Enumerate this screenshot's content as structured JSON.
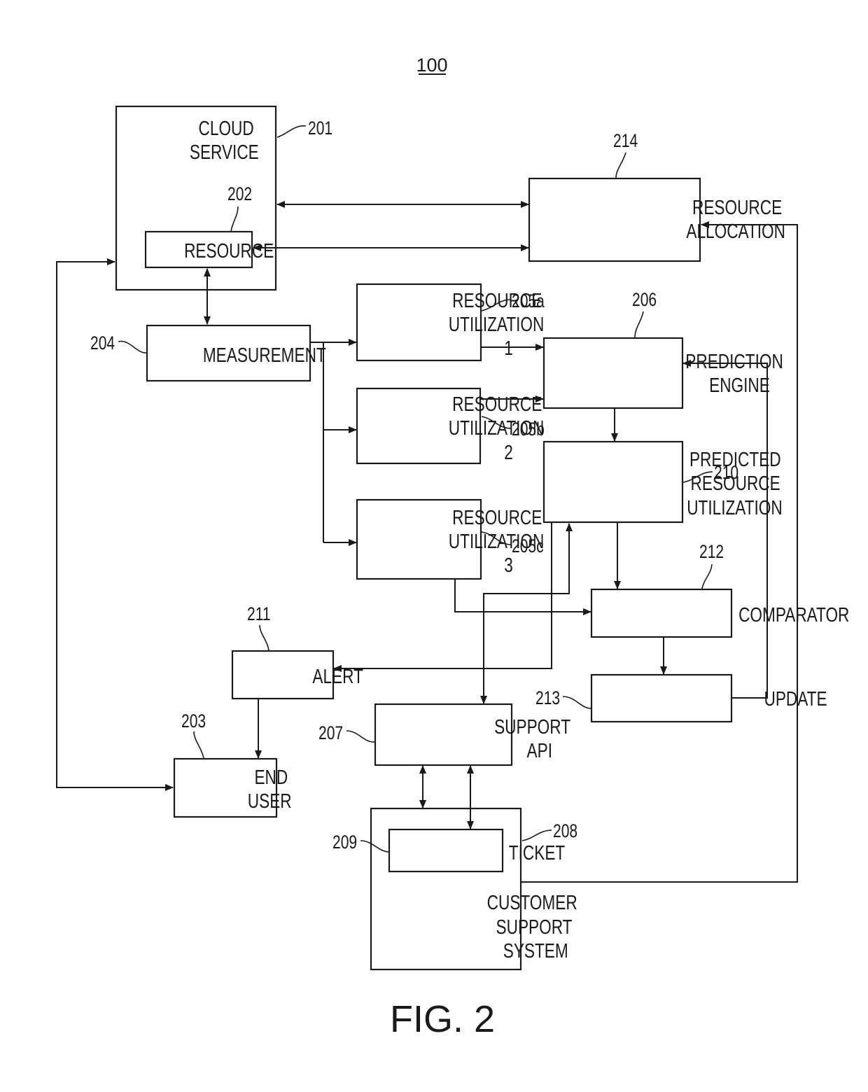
{
  "figure": {
    "number_label": "100",
    "caption": "FIG. 2"
  },
  "nodes": {
    "cloud_service": {
      "ref": "201",
      "lines": [
        "CLOUD",
        "SERVICE"
      ]
    },
    "resource": {
      "ref": "202",
      "lines": [
        "RESOURCE"
      ]
    },
    "end_user": {
      "ref": "203",
      "lines": [
        "END",
        "USER"
      ]
    },
    "measurement": {
      "ref": "204",
      "lines": [
        "MEASUREMENT"
      ]
    },
    "resource_utilization_1": {
      "ref": "205a",
      "lines": [
        "RESOURCE",
        "UTILIZATION",
        "1"
      ]
    },
    "resource_utilization_2": {
      "ref": "205b",
      "lines": [
        "RESOURCE",
        "UTILIZATION",
        "2"
      ]
    },
    "resource_utilization_3": {
      "ref": "205c",
      "lines": [
        "RESOURCE",
        "UTILIZATION",
        "3"
      ]
    },
    "prediction_engine": {
      "ref": "206",
      "lines": [
        "PREDICTION",
        "ENGINE"
      ]
    },
    "support_api": {
      "ref": "207",
      "lines": [
        "SUPPORT",
        "API"
      ]
    },
    "customer_support_system": {
      "ref": "208",
      "lines": [
        "CUSTOMER",
        "SUPPORT",
        "SYSTEM"
      ]
    },
    "ticket": {
      "ref": "209",
      "lines": [
        "TICKET"
      ]
    },
    "predicted_resource_utilization": {
      "ref": "210",
      "lines": [
        "PREDICTED",
        "RESOURCE",
        "UTILIZATION"
      ]
    },
    "alert": {
      "ref": "211",
      "lines": [
        "ALERT"
      ]
    },
    "comparator": {
      "ref": "212",
      "lines": [
        "COMPARATOR"
      ]
    },
    "update": {
      "ref": "213",
      "lines": [
        "UPDATE"
      ]
    },
    "resource_allocation": {
      "ref": "214",
      "lines": [
        "RESOURCE",
        "ALLOCATION"
      ]
    }
  },
  "edges": [
    {
      "from": "cloud_service",
      "to": "resource_allocation",
      "direction": "bidirectional"
    },
    {
      "from": "resource",
      "to": "resource_allocation",
      "direction": "bidirectional"
    },
    {
      "from": "resource",
      "to": "measurement",
      "direction": "bidirectional"
    },
    {
      "from": "end_user",
      "to": "cloud_service",
      "direction": "bidirectional"
    },
    {
      "from": "measurement",
      "to": "resource_utilization_1",
      "direction": "forward"
    },
    {
      "from": "measurement",
      "to": "resource_utilization_2",
      "direction": "forward"
    },
    {
      "from": "measurement",
      "to": "resource_utilization_3",
      "direction": "forward"
    },
    {
      "from": "resource_utilization_1",
      "to": "prediction_engine",
      "direction": "forward"
    },
    {
      "from": "resource_utilization_2",
      "to": "prediction_engine",
      "direction": "forward"
    },
    {
      "from": "prediction_engine",
      "to": "predicted_resource_utilization",
      "direction": "forward"
    },
    {
      "from": "predicted_resource_utilization",
      "to": "comparator",
      "direction": "forward"
    },
    {
      "from": "resource_utilization_3",
      "to": "comparator",
      "direction": "forward"
    },
    {
      "from": "predicted_resource_utilization",
      "to": "alert",
      "direction": "forward"
    },
    {
      "from": "support_api",
      "to": "predicted_resource_utilization",
      "direction": "bidirectional"
    },
    {
      "from": "comparator",
      "to": "update",
      "direction": "forward"
    },
    {
      "from": "update",
      "to": "prediction_engine",
      "direction": "forward"
    },
    {
      "from": "alert",
      "to": "end_user",
      "direction": "forward"
    },
    {
      "from": "support_api",
      "to": "customer_support_system",
      "direction": "bidirectional"
    },
    {
      "from": "support_api",
      "to": "ticket",
      "direction": "bidirectional"
    },
    {
      "from": "customer_support_system",
      "to": "resource_allocation",
      "direction": "forward"
    }
  ]
}
